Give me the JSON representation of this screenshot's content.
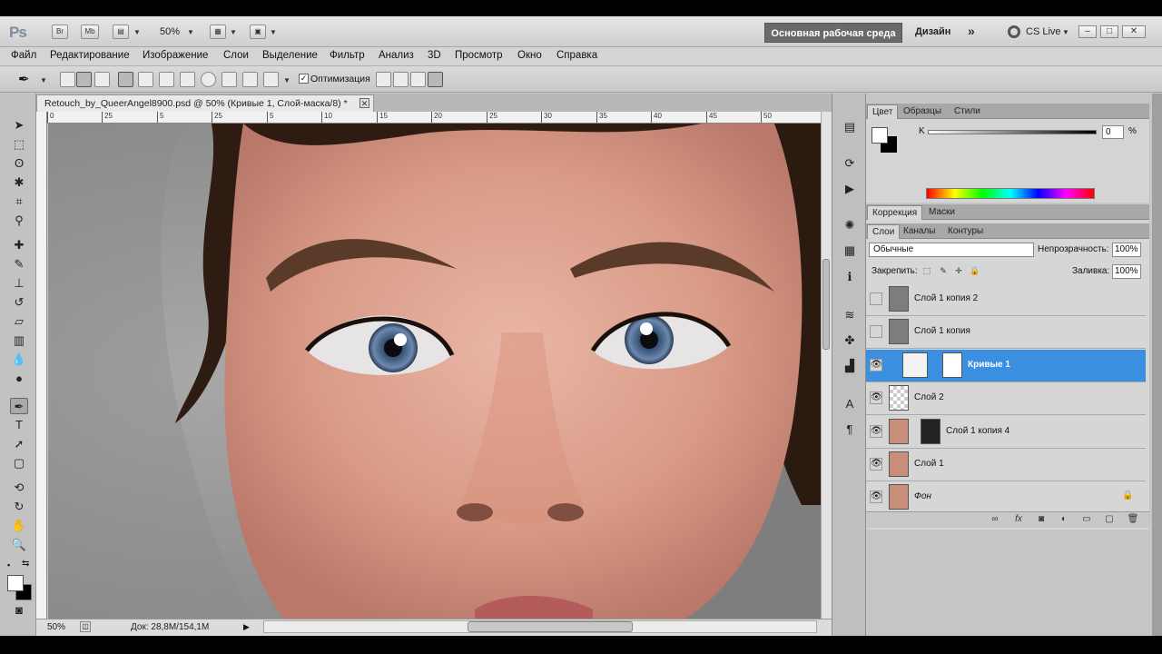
{
  "appbar": {
    "logo": "Ps",
    "btn_br": "Br",
    "btn_mb": "Mb",
    "zoom": "50%",
    "workspace_main": "Основная рабочая среда",
    "workspace_design": "Дизайн",
    "cs_live": "CS Live"
  },
  "menu": [
    "Файл",
    "Редактирование",
    "Изображение",
    "Слои",
    "Выделение",
    "Фильтр",
    "Анализ",
    "3D",
    "Просмотр",
    "Окно",
    "Справка"
  ],
  "options": {
    "autoadd_label": "Оптимизация",
    "autoadd_checked": true
  },
  "document": {
    "tab_title": "Retouch_by_QueerAngel8900.psd @ 50% (Кривые 1, Слой-маска/8) *",
    "ruler_ticks": [
      "0",
      "25",
      "5",
      "25",
      "5",
      "10",
      "15",
      "20",
      "25",
      "30",
      "35",
      "40",
      "45",
      "50"
    ],
    "status_zoom": "50%",
    "status_doc": "Док: 28,8M/154,1M"
  },
  "color_panel": {
    "tabs": [
      "Цвет",
      "Образцы",
      "Стили"
    ],
    "k_label": "K",
    "k_value": "0",
    "pct": "%"
  },
  "adjust_panel": {
    "tabs": [
      "Коррекция",
      "Маски"
    ]
  },
  "layers_panel": {
    "tabs": [
      "Слои",
      "Каналы",
      "Контуры"
    ],
    "blend_mode": "Обычные",
    "opacity_label": "Непрозрачность:",
    "opacity_value": "100%",
    "lock_label": "Закрепить:",
    "fill_label": "Заливка:",
    "fill_value": "100%",
    "layers": [
      {
        "name": "Слой 1 копия 2",
        "visible": false
      },
      {
        "name": "Слой 1 копия",
        "visible": false
      },
      {
        "name": "Кривые 1",
        "visible": true,
        "active": true
      },
      {
        "name": "Слой 2",
        "visible": true
      },
      {
        "name": "Слой 1 копия 4",
        "visible": true
      },
      {
        "name": "Слой 1",
        "visible": true
      },
      {
        "name": "Фон",
        "visible": true,
        "locked": true
      }
    ]
  },
  "colors": {
    "active_layer": "#3b8fe0",
    "workspace_button": "#6a6a6a"
  }
}
